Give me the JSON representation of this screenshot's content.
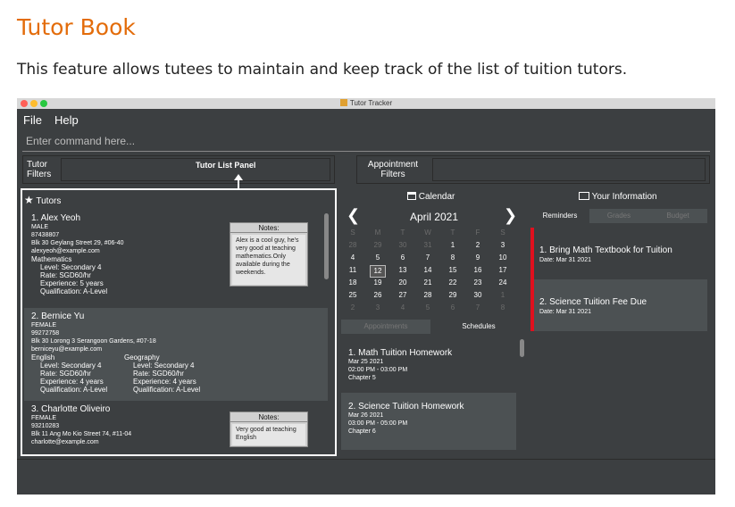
{
  "doc": {
    "title": "Tutor Book",
    "description": "This feature allows tutees to maintain and keep track of the list of tuition tutors."
  },
  "window": {
    "title": "Tutor Tracker",
    "traffic_colors": [
      "#ff5f57",
      "#febc2e",
      "#28c840"
    ]
  },
  "menu": {
    "file": "File",
    "help": "Help"
  },
  "command": {
    "placeholder": "Enter command here..."
  },
  "filters": {
    "tutor_line1": "Tutor",
    "tutor_line2": "Filters",
    "appointment_line1": "Appointment",
    "appointment_line2": "Filters"
  },
  "annotation": {
    "label": "Tutor List Panel"
  },
  "tutors_panel": {
    "title": "Tutors",
    "tutors": [
      {
        "index_name": "1.  Alex Yeoh",
        "gender": "MALE",
        "phone": "87438807",
        "address": "Blk 30 Geylang Street 29, #06-40",
        "email": "alexyeoh@example.com",
        "subject": "Mathematics",
        "level": "Level: Secondary 4",
        "rate": "Rate: SGD60/hr",
        "experience": "Experience: 5 years",
        "qualification": "Qualification: A-Level",
        "notes_header": "Notes:",
        "notes": "Alex is a cool guy, he's very good at teaching mathematics.Only available during the weekends."
      },
      {
        "index_name": "2.  Bernice Yu",
        "gender": "FEMALE",
        "phone": "99272758",
        "address": "Blk 30 Lorong 3 Serangoon Gardens, #07-18",
        "email": "berniceyu@example.com",
        "subject1": "English",
        "subject2": "Geography",
        "level1": "Level: Secondary 4",
        "level2": "Level: Secondary 4",
        "rate1": "Rate: SGD60/hr",
        "rate2": "Rate: SGD60/hr",
        "experience1": "Experience: 4 years",
        "experience2": "Experience: 4 years",
        "qualification1": "Qualification: A-Level",
        "qualification2": "Qualification: A-Level"
      },
      {
        "index_name": "3.  Charlotte Oliveiro",
        "gender": "FEMALE",
        "phone": "93210283",
        "address": "Blk 11 Ang Mo Kio Street 74, #11-04",
        "email": "charlotte@example.com",
        "notes_header": "Notes:",
        "notes": "Very good at teaching English"
      }
    ]
  },
  "calendar": {
    "header": "Calendar",
    "month_year": "April  2021",
    "prev": "❮",
    "next": "❯",
    "weekdays": [
      "S",
      "M",
      "T",
      "W",
      "T",
      "F",
      "S"
    ],
    "weeks": [
      [
        "28",
        "29",
        "30",
        "31",
        "1",
        "2",
        "3"
      ],
      [
        "4",
        "5",
        "6",
        "7",
        "8",
        "9",
        "10"
      ],
      [
        "11",
        "12",
        "13",
        "14",
        "15",
        "16",
        "17"
      ],
      [
        "18",
        "19",
        "20",
        "21",
        "22",
        "23",
        "24"
      ],
      [
        "25",
        "26",
        "27",
        "28",
        "29",
        "30",
        "1"
      ],
      [
        "2",
        "3",
        "4",
        "5",
        "6",
        "7",
        "8"
      ]
    ],
    "today": "12",
    "tabs": {
      "appointments": "Appointments",
      "schedules": "Schedules"
    }
  },
  "schedules": [
    {
      "title": "1.  Math Tuition Homework",
      "date": "Mar 25 2021",
      "time": "02:00 PM - 03:00 PM",
      "desc": "Chapter 5"
    },
    {
      "title": "2.  Science Tuition Homework",
      "date": "Mar 26 2021",
      "time": "03:00 PM - 05:00 PM",
      "desc": "Chapter 6"
    }
  ],
  "info": {
    "header": "Your Information",
    "tabs": {
      "reminders": "Reminders",
      "grades": "Grades",
      "budget": "Budget"
    },
    "reminders": [
      {
        "title": "1.  Bring Math Textbook for Tuition",
        "date": "Date: Mar 31 2021"
      },
      {
        "title": "2.  Science Tuition Fee Due",
        "date": "Date: Mar 31 2021"
      }
    ]
  }
}
